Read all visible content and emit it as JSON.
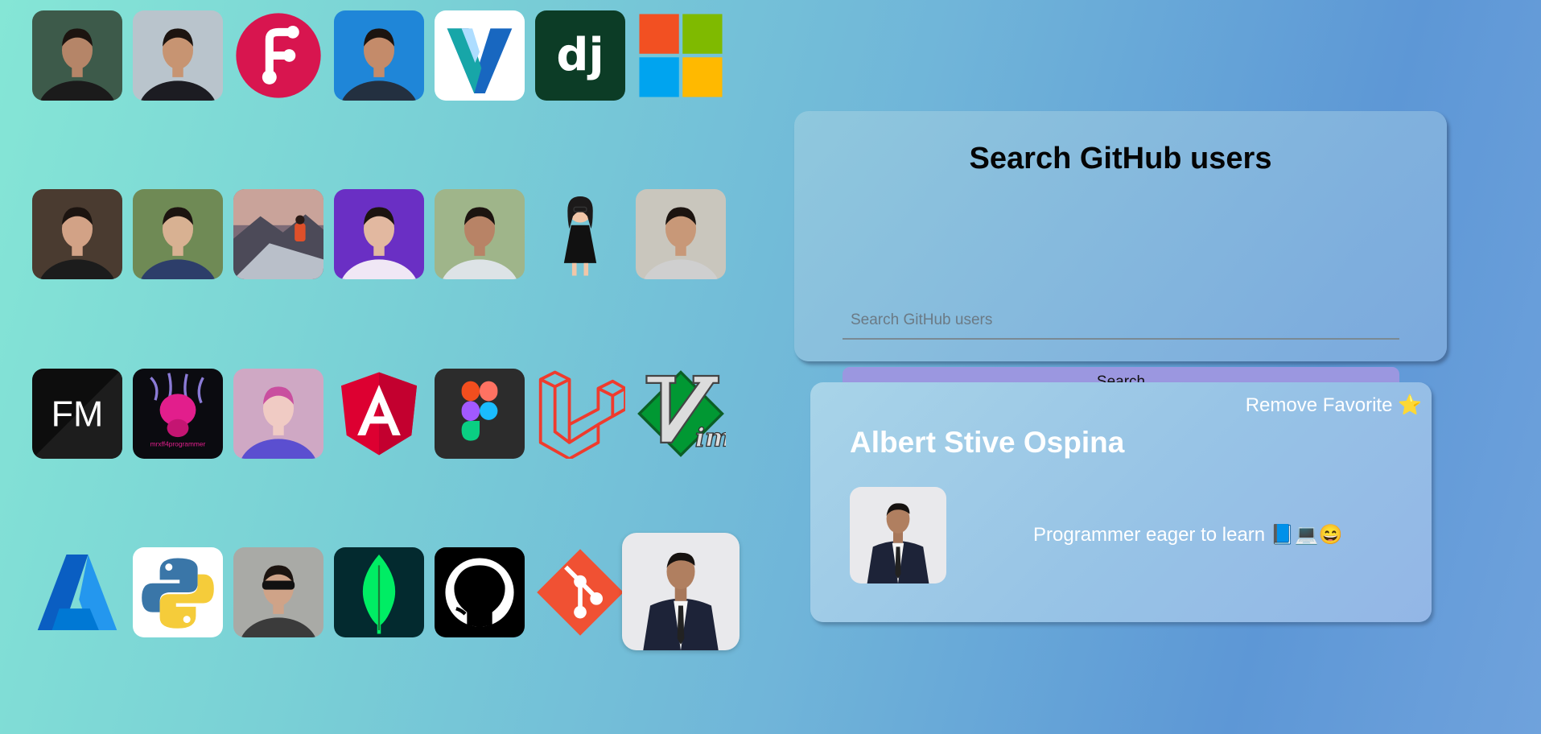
{
  "avatars": [
    {
      "name": "user-avatar-1",
      "kind": "photo",
      "bg": "#3d5a4a",
      "skin": "#b58568",
      "shirt": "#1b1b1b"
    },
    {
      "name": "user-avatar-2",
      "kind": "photo",
      "bg": "#b9c4cc",
      "skin": "#c79472",
      "shirt": "#1c1c22"
    },
    {
      "name": "fork-logo-avatar",
      "kind": "fork-logo",
      "color": "#d8154f"
    },
    {
      "name": "user-avatar-3",
      "kind": "photo",
      "bg": "#1f86d8",
      "skin": "#c48b6a",
      "shirt": "#233040"
    },
    {
      "name": "vuetify-logo-avatar",
      "kind": "vuetify-logo"
    },
    {
      "name": "django-logo-avatar",
      "kind": "django-logo",
      "text": "dj"
    },
    {
      "name": "microsoft-logo-avatar",
      "kind": "microsoft-logo"
    },
    {
      "name": "user-avatar-4",
      "kind": "photo",
      "bg": "#4a3b30",
      "skin": "#d2a286",
      "shirt": "#1c1c1c"
    },
    {
      "name": "user-avatar-5",
      "kind": "photo",
      "bg": "#6f8a55",
      "skin": "#d8b192",
      "shirt": "#2d3e6a"
    },
    {
      "name": "user-avatar-6",
      "kind": "landscape"
    },
    {
      "name": "user-avatar-7",
      "kind": "photo",
      "bg": "#6a2fc4",
      "skin": "#e2b8a0",
      "shirt": "#f0e7f5"
    },
    {
      "name": "user-avatar-8",
      "kind": "photo",
      "bg": "#9fb58a",
      "skin": "#b88366",
      "shirt": "#dde3e6"
    },
    {
      "name": "user-avatar-9",
      "kind": "cartoon"
    },
    {
      "name": "user-avatar-10",
      "kind": "photo",
      "bg": "#c9c6bd",
      "skin": "#c89878",
      "shirt": "#cfcfcf"
    },
    {
      "name": "frontend-mentor-logo-avatar",
      "kind": "fm-logo",
      "text": "FM"
    },
    {
      "name": "user-avatar-11",
      "kind": "art",
      "text": "mrxff4programmer"
    },
    {
      "name": "user-avatar-12",
      "kind": "photo",
      "bg": "#cfa8c4",
      "skin": "#f0cbc4",
      "shirt": "#5b4fd0",
      "hair": "#c94f9f"
    },
    {
      "name": "angular-logo-avatar",
      "kind": "angular-logo"
    },
    {
      "name": "figma-logo-avatar",
      "kind": "figma-logo"
    },
    {
      "name": "laravel-logo-avatar",
      "kind": "laravel-logo"
    },
    {
      "name": "vim-logo-avatar",
      "kind": "vim-logo"
    },
    {
      "name": "azure-logo-avatar",
      "kind": "azure-logo"
    },
    {
      "name": "python-logo-avatar",
      "kind": "python-logo"
    },
    {
      "name": "user-avatar-13",
      "kind": "photo",
      "bg": "#a9aaa6",
      "skin": "#cfa388",
      "shirt": "#3b3b3b",
      "glasses": true
    },
    {
      "name": "mongodb-logo-avatar",
      "kind": "mongodb-logo"
    },
    {
      "name": "github-logo-avatar",
      "kind": "github-logo"
    },
    {
      "name": "git-logo-avatar",
      "kind": "git-logo"
    },
    {
      "name": "selected-user-avatar",
      "kind": "suit-photo",
      "big": true
    }
  ],
  "search": {
    "title": "Search GitHub users",
    "placeholder": "Search GitHub users",
    "value": "",
    "button_label": "Search"
  },
  "profile": {
    "favorite_label": "Remove Favorite ⭐",
    "name": "Albert Stive Ospina",
    "bio": "Programmer eager to learn 📘💻😄"
  },
  "colors": {
    "search_button": "#9b97e0",
    "django": "#0c3c26",
    "github": "#000000"
  }
}
